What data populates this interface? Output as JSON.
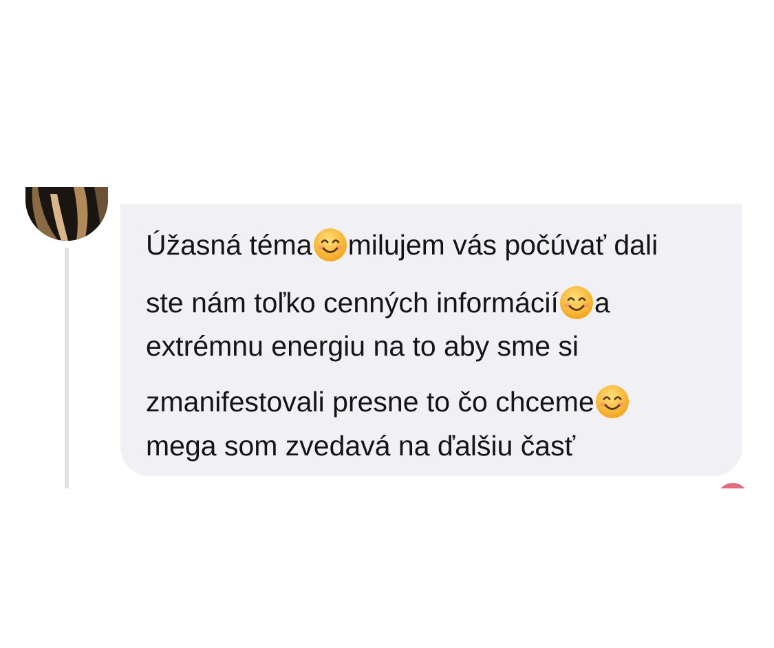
{
  "comment": {
    "author_avatar": "avatar",
    "lines": [
      {
        "segments": [
          "Úžasná téma",
          "smiling-face-icon",
          "milujem vás počúvať dali"
        ]
      },
      {
        "segments": [
          "ste nám toľko cenných informácií",
          "smiling-face-icon",
          "a"
        ]
      },
      {
        "segments": [
          "extrémnu energiu na to aby sme si"
        ]
      },
      {
        "segments": [
          "zmanifestovali presne to čo chceme",
          "smiling-face-icon"
        ]
      },
      {
        "segments": [
          "mega som zvedavá na ďalšiu časť"
        ]
      }
    ],
    "l1a": "Úžasná téma",
    "l1b": "milujem vás počúvať dali",
    "l2a": "ste nám toľko cenných informácií",
    "l2b": "a",
    "l3": "extrémnu energiu na to aby sme si",
    "l4a": "zmanifestovali presne to čo chceme",
    "l5": "mega som zvedavá na ďalšiu časť"
  },
  "colors": {
    "bubble_background": "#f0f0f5",
    "thread_line": "#e1e1e8",
    "text": "#141414",
    "reaction": "#e06b7a"
  }
}
